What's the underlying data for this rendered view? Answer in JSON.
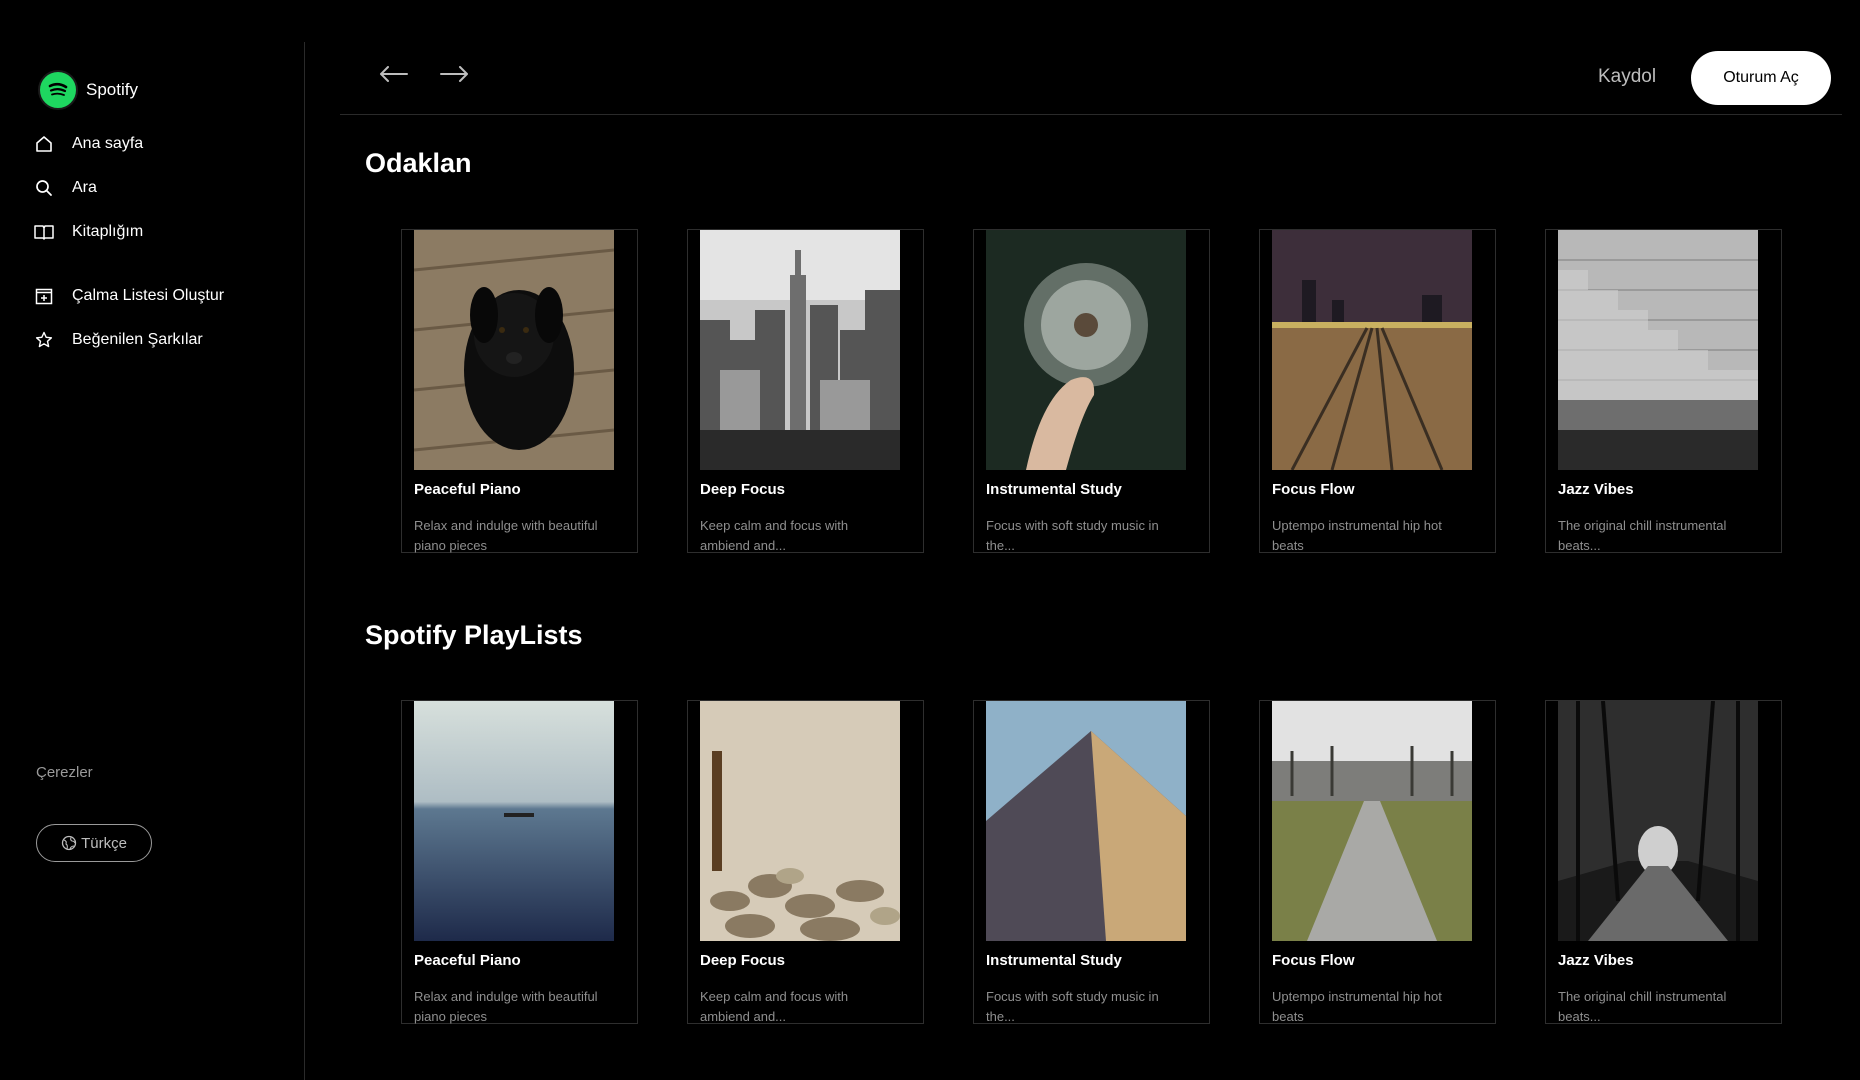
{
  "app": {
    "name": "Spotify"
  },
  "sidebar": {
    "items": [
      {
        "label": "Ana sayfa",
        "icon": "home-icon"
      },
      {
        "label": "Ara",
        "icon": "search-icon"
      },
      {
        "label": "Kitaplığım",
        "icon": "library-icon"
      },
      {
        "label": "Çalma Listesi Oluştur",
        "icon": "add-playlist-icon"
      },
      {
        "label": "Beğenilen Şarkılar",
        "icon": "star-icon"
      }
    ],
    "cookies_label": "Çerezler",
    "language_label": "Türkçe"
  },
  "header": {
    "signup_label": "Kaydol",
    "login_label": "Oturum Aç"
  },
  "sections": [
    {
      "title": "Odaklan",
      "cards": [
        {
          "title": "Peaceful Piano",
          "desc": "Relax and indulge with beautiful piano pieces",
          "image": "black puppy"
        },
        {
          "title": "Deep Focus",
          "desc": "Keep calm and focus with ambiend and...",
          "image": "city skyline"
        },
        {
          "title": "Instrumental Study",
          "desc": "Focus with soft study music in the...",
          "image": "dandelion"
        },
        {
          "title": "Focus Flow",
          "desc": "Uptempo instrumental hip hot beats",
          "image": "railway tracks"
        },
        {
          "title": "Jazz Vibes",
          "desc": "The original chill instrumental beats...",
          "image": "stone steps"
        }
      ]
    },
    {
      "title": "Spotify PlayLists",
      "cards": [
        {
          "title": "Peaceful Piano",
          "desc": "Relax and indulge with beautiful piano pieces",
          "image": "calm sea"
        },
        {
          "title": "Deep Focus",
          "desc": "Keep calm and focus with ambiend and...",
          "image": "rocky shore"
        },
        {
          "title": "Instrumental Study",
          "desc": "Focus with soft study music in the...",
          "image": "sand dune"
        },
        {
          "title": "Focus Flow",
          "desc": "Uptempo instrumental hip hot beats",
          "image": "tree path"
        },
        {
          "title": "Jazz Vibes",
          "desc": "The original chill instrumental beats...",
          "image": "forest road"
        }
      ]
    }
  ],
  "colors": {
    "brand": "#1ed760",
    "background": "#000000",
    "muted_text": "#8f8f8f"
  }
}
